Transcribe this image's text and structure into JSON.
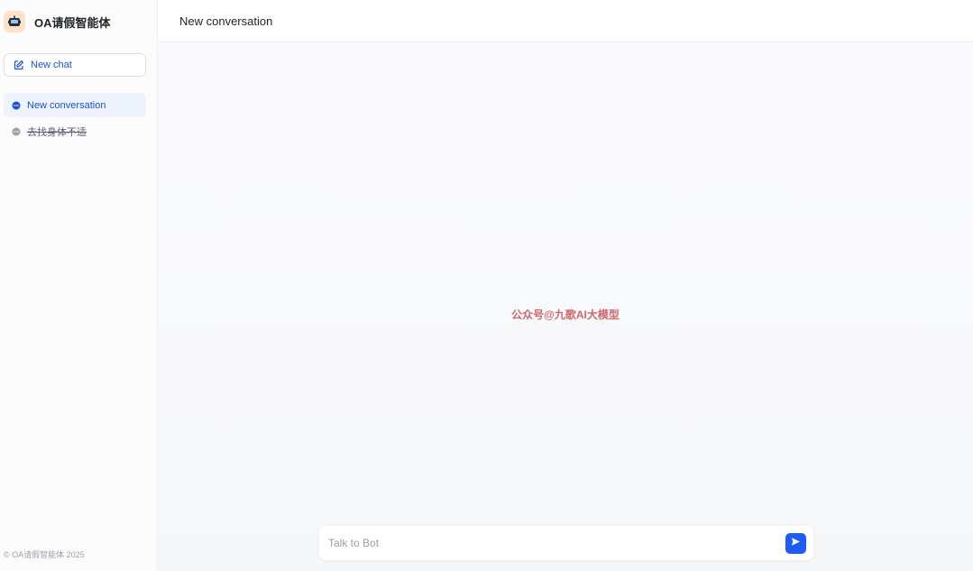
{
  "app": {
    "title": "OA请假智能体",
    "logo_icon": "robot-icon",
    "footer": "© OA请假智能体 2025"
  },
  "sidebar": {
    "new_chat": {
      "label": "New chat",
      "icon": "edit-icon"
    },
    "conversations": [
      {
        "label": "New conversation",
        "icon": "chat-bubble-icon",
        "active": true
      },
      {
        "label": "去找身体不适",
        "icon": "chat-bubble-icon",
        "active": false
      }
    ]
  },
  "header": {
    "title": "New conversation"
  },
  "main": {
    "watermark": "公众号@九歌AI大模型"
  },
  "composer": {
    "placeholder": "Talk to Bot",
    "send_icon": "send-icon"
  },
  "colors": {
    "accent": "#1e5cf5",
    "active_bg": "#eef3fe",
    "watermark": "#d0676a"
  }
}
